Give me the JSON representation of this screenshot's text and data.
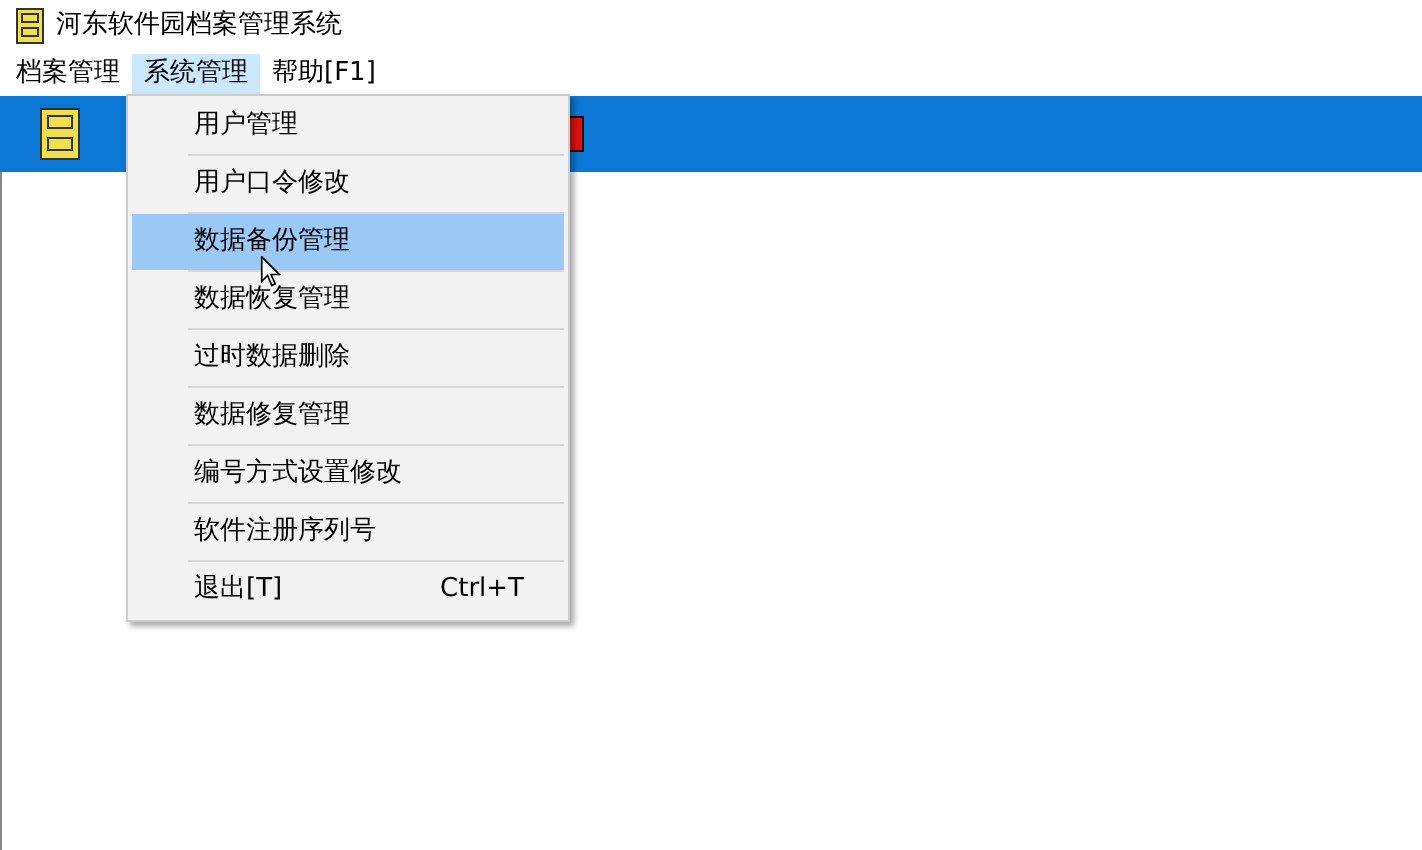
{
  "window": {
    "title": "河东软件园档案管理系统"
  },
  "menu_bar": [
    {
      "label": "档案管理",
      "selected": false
    },
    {
      "label": "系统管理",
      "selected": true
    },
    {
      "label": "帮助[F1]",
      "selected": false
    }
  ],
  "dropdown": [
    {
      "label": "用户管理",
      "selected": false
    },
    {
      "label": "用户口令修改",
      "selected": false
    },
    {
      "label": "数据备份管理",
      "selected": true
    },
    {
      "label": "数据恢复管理",
      "selected": false
    },
    {
      "label": "过时数据删除",
      "selected": false
    },
    {
      "label": "数据修复管理",
      "selected": false
    },
    {
      "label": "编号方式设置修改",
      "selected": false
    },
    {
      "label": "软件注册序列号",
      "selected": false
    },
    {
      "label": "退出[T]",
      "shortcut": "Ctrl+T",
      "selected": false
    }
  ]
}
